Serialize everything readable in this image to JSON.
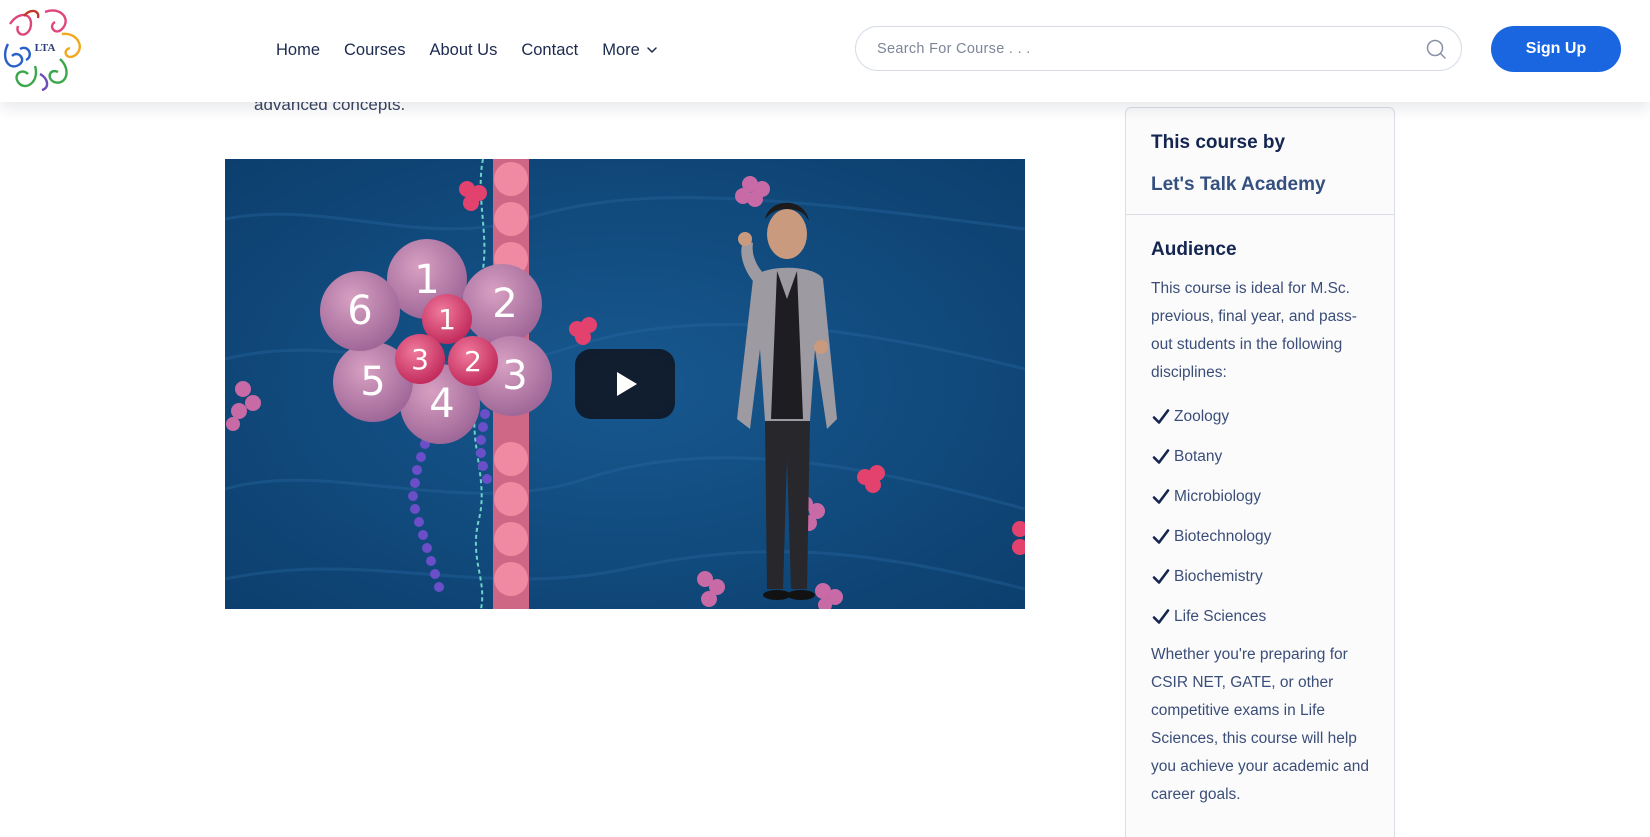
{
  "header": {
    "logo": {
      "icon": "lta-logo-icon",
      "text": "LTA"
    },
    "nav": [
      {
        "label": "Home"
      },
      {
        "label": "Courses"
      },
      {
        "label": "About Us"
      },
      {
        "label": "Contact"
      },
      {
        "label": "More",
        "icon": "chevron-down-icon"
      }
    ],
    "search": {
      "placeholder": "Search For Course . . .",
      "value": "",
      "icon": "search-icon"
    },
    "signup_label": "Sign Up"
  },
  "main": {
    "intro_tail": "advanced concepts.",
    "video": {
      "play_icon": "play-icon",
      "flower_numbers": [
        "1",
        "2",
        "3",
        "4",
        "5",
        "6",
        "1",
        "2",
        "3"
      ]
    }
  },
  "sidebar": {
    "by_label": "This course by",
    "org_name": "Let's Talk Academy",
    "audience_title": "Audience",
    "audience_desc": "This course is ideal for M.Sc. previous, final year, and pass-out students in the following disciplines:",
    "disciplines": [
      "Zoology",
      "Botany",
      "Microbiology",
      "Biotechnology",
      "Biochemistry",
      "Life Sciences"
    ],
    "check_icon": "checkmark-icon",
    "outro": "Whether you're preparing for CSIR NET, GATE, or other competitive exams in Life Sciences, this course will help you achieve your academic and career goals."
  },
  "colors": {
    "primary": "#1a66e0",
    "heading": "#142550",
    "body_text": "#3b4e78",
    "video_bg": "#0f4a7e"
  }
}
